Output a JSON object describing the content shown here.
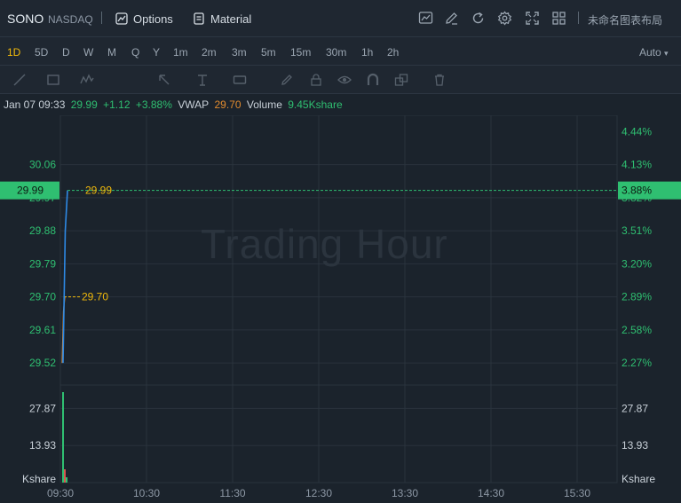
{
  "header": {
    "symbol": "SONO",
    "exchange": "NASDAQ",
    "options_label": "Options",
    "material_label": "Material",
    "layout_name": "未命名图表布局",
    "icons": [
      "chart-icon",
      "edit-icon",
      "refresh-icon",
      "settings-icon",
      "fullscreen-icon",
      "layout-grid-icon"
    ]
  },
  "timeframes": {
    "items": [
      "1D",
      "5D",
      "D",
      "W",
      "M",
      "Q",
      "Y",
      "1m",
      "2m",
      "3m",
      "5m",
      "15m",
      "30m",
      "1h",
      "2h"
    ],
    "active": "1D",
    "auto_label": "Auto"
  },
  "drawing_tools": [
    "line-tool-icon",
    "rectangle-tool-icon",
    "pattern-tool-icon",
    "arrow-tool-icon",
    "text-tool-icon",
    "label-tool-icon",
    "pen-icon",
    "lock-icon",
    "eye-icon",
    "magnet-icon",
    "layers-icon",
    "trash-icon"
  ],
  "legend": {
    "datetime": "Jan 07 09:33",
    "price": "29.99",
    "change": "+1.12",
    "change_pct": "+3.88%",
    "vwap_label": "VWAP",
    "vwap_value": "29.70",
    "volume_label": "Volume",
    "volume_value": "9.45Kshare"
  },
  "watermark": "Trading Hour",
  "colors": {
    "up": "#2fbf71",
    "price_line": "#2e8ae6",
    "vwap_line": "#e08a2e",
    "highlight": "#f0b90b",
    "grid": "#2a333d"
  },
  "chart_data": {
    "type": "line",
    "x_ticks": [
      "09:30",
      "10:30",
      "11:30",
      "12:30",
      "13:30",
      "14:30",
      "15:30"
    ],
    "price_ticks_left": [
      "30.06",
      "29.97",
      "29.88",
      "29.79",
      "29.70",
      "29.61",
      "29.52"
    ],
    "pct_ticks_right": [
      "4.44%",
      "4.13%",
      "3.82%",
      "3.51%",
      "3.20%",
      "2.89%",
      "2.58%",
      "2.27%"
    ],
    "ylim": [
      29.46,
      30.18
    ],
    "current_price": 29.99,
    "current_price_label": "29.99",
    "current_pct_label": "3.88%",
    "vwap": 29.7,
    "vwap_label": "29.70",
    "series": [
      {
        "name": "Price",
        "values": [
          29.52,
          29.88,
          29.99
        ]
      },
      {
        "name": "VWAP",
        "values": [
          29.52,
          29.66,
          29.7
        ]
      }
    ],
    "volume": {
      "ticks_left": [
        "27.87",
        "13.93"
      ],
      "ticks_right": [
        "27.87",
        "13.93"
      ],
      "unit": "Kshare",
      "ylim": [
        0,
        36
      ],
      "bars": [
        34,
        5,
        2
      ]
    }
  }
}
